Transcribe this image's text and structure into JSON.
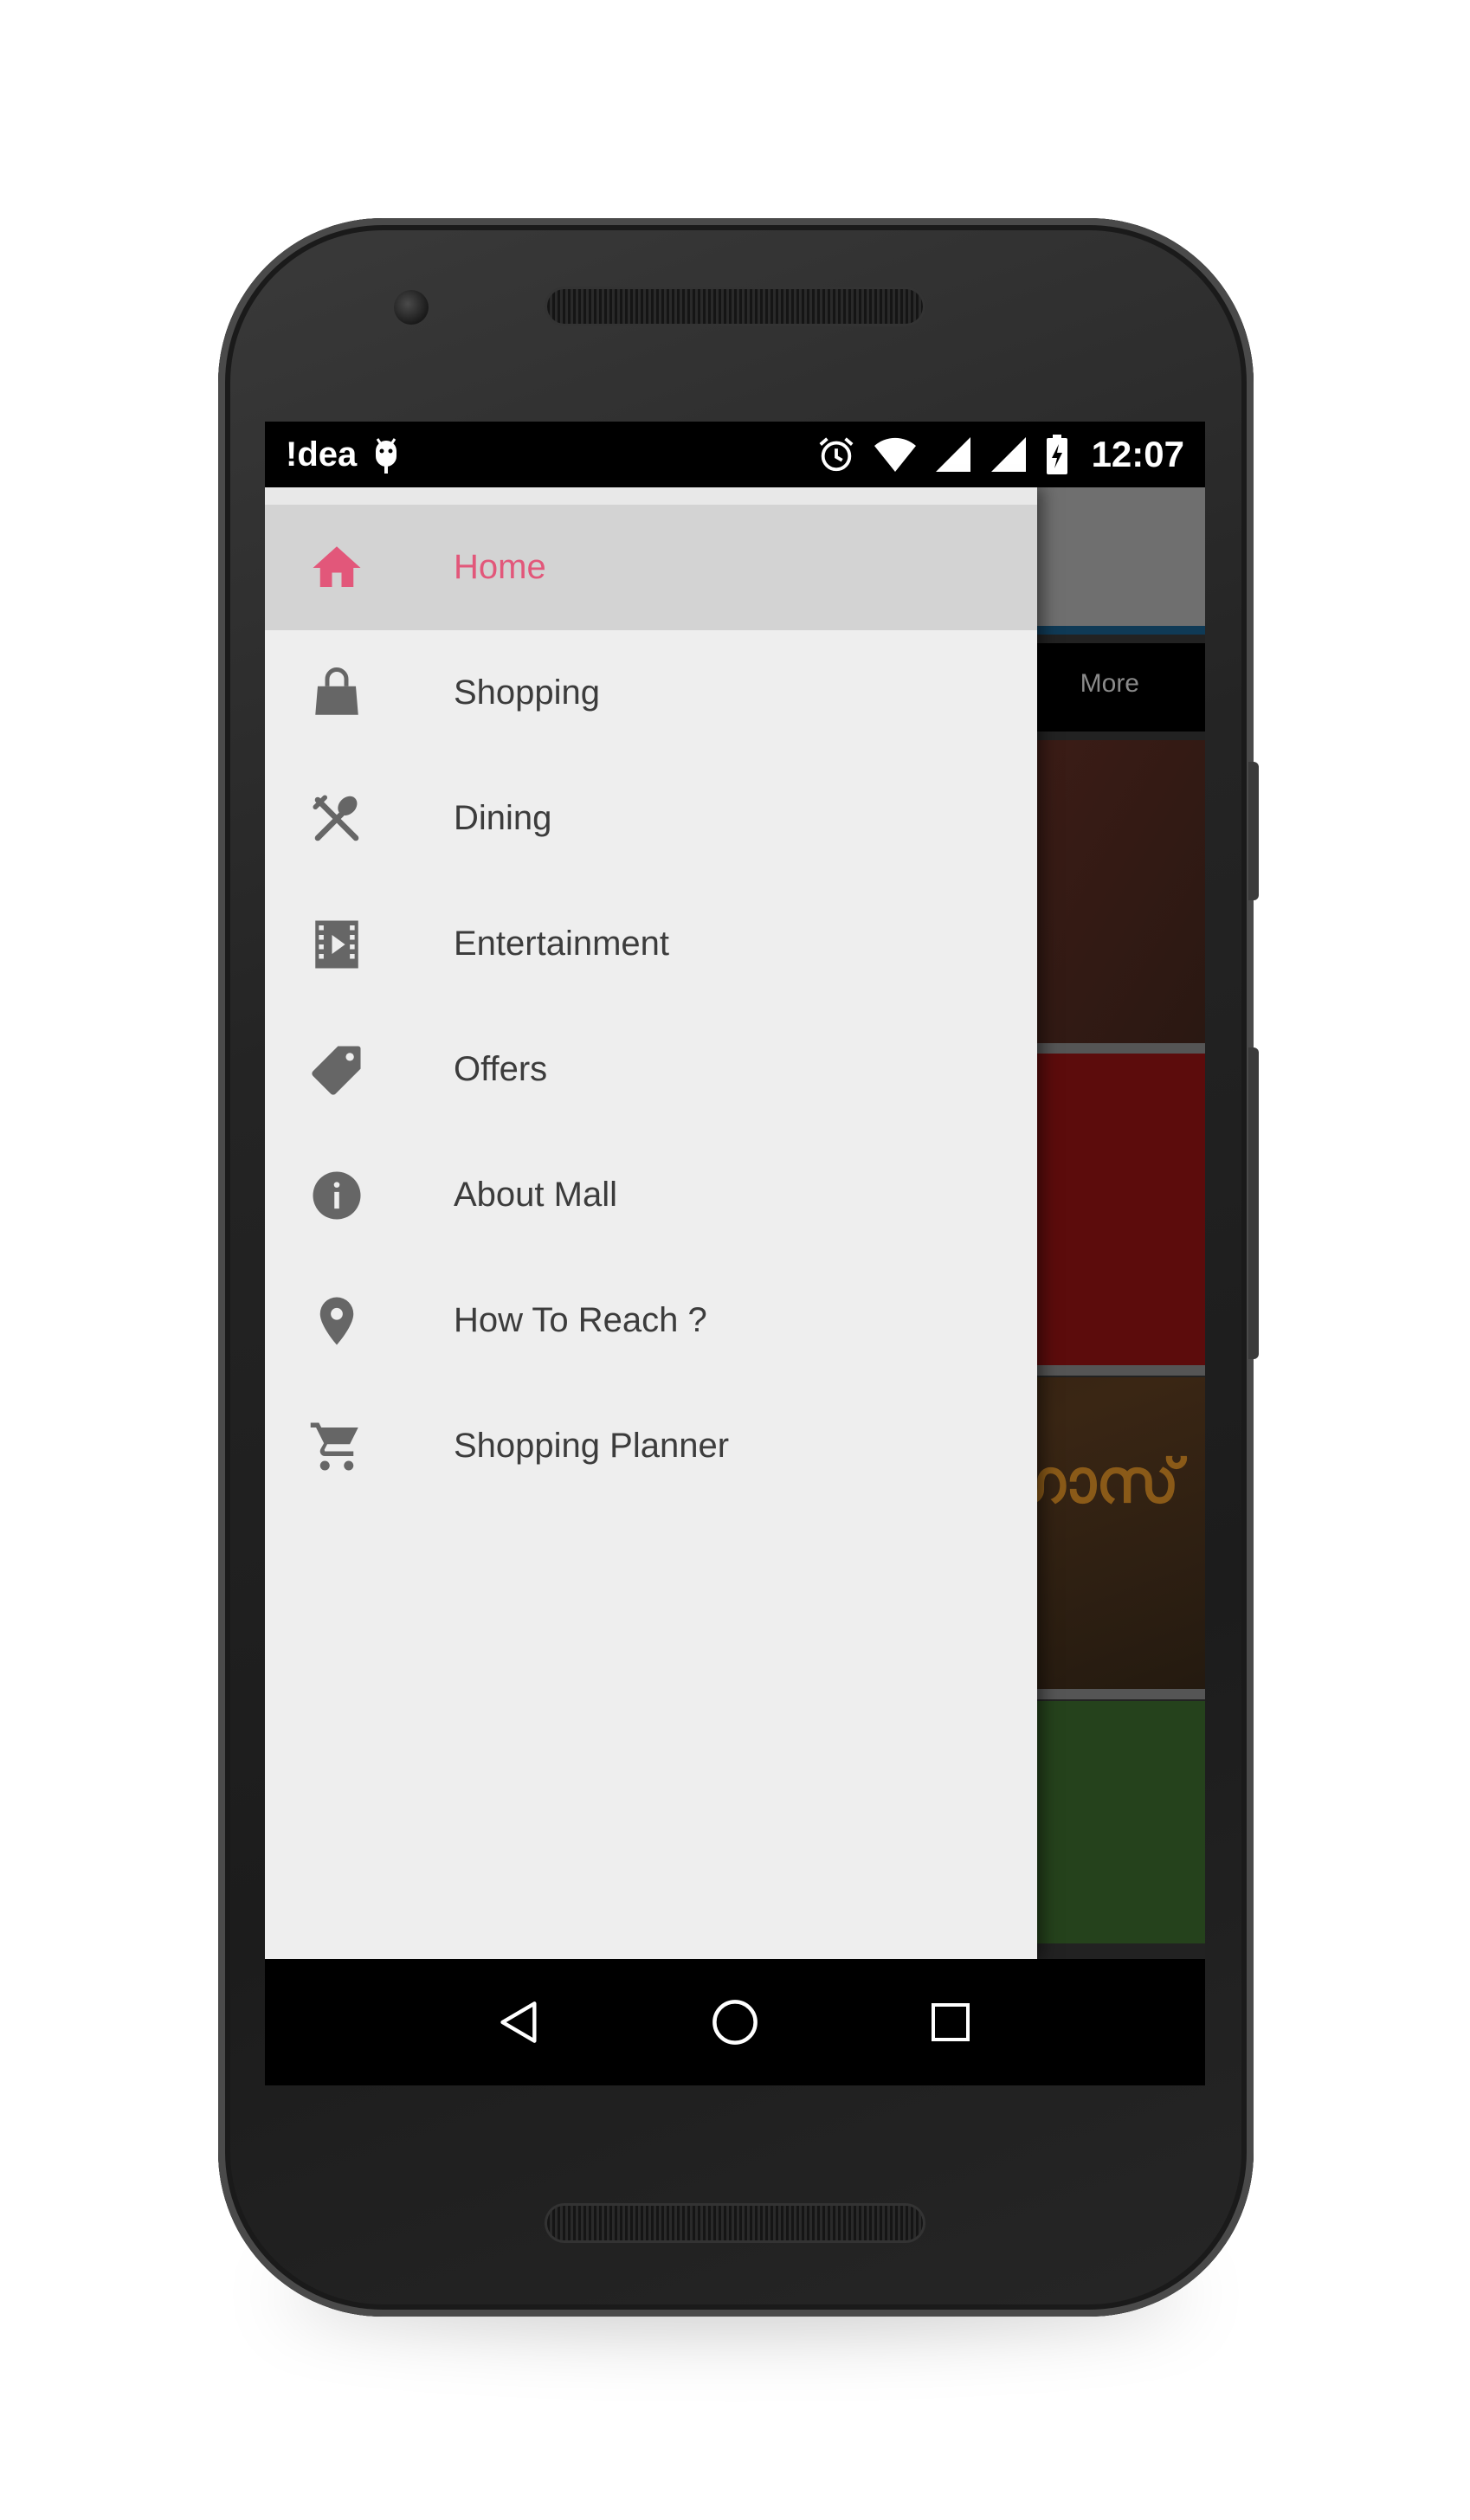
{
  "statusbar": {
    "carrier": "!dea",
    "time": "12:07"
  },
  "background_app": {
    "tab_more": "More",
    "poster_text": "സൺ ഗാസ്"
  },
  "drawer": {
    "items": [
      {
        "label": "Home",
        "icon": "home-icon",
        "active": true
      },
      {
        "label": "Shopping",
        "icon": "shopping-bag-icon",
        "active": false
      },
      {
        "label": "Dining",
        "icon": "dining-icon",
        "active": false
      },
      {
        "label": "Entertainment",
        "icon": "film-icon",
        "active": false
      },
      {
        "label": "Offers",
        "icon": "tag-icon",
        "active": false
      },
      {
        "label": "About Mall",
        "icon": "info-icon",
        "active": false
      },
      {
        "label": "How To Reach ?",
        "icon": "location-pin-icon",
        "active": false
      },
      {
        "label": "Shopping Planner",
        "icon": "cart-icon",
        "active": false
      }
    ]
  },
  "colors": {
    "accent": "#e2577a",
    "icon": "#666666",
    "drawer_bg": "#eeeeee",
    "active_bg": "#d3d3d3"
  }
}
